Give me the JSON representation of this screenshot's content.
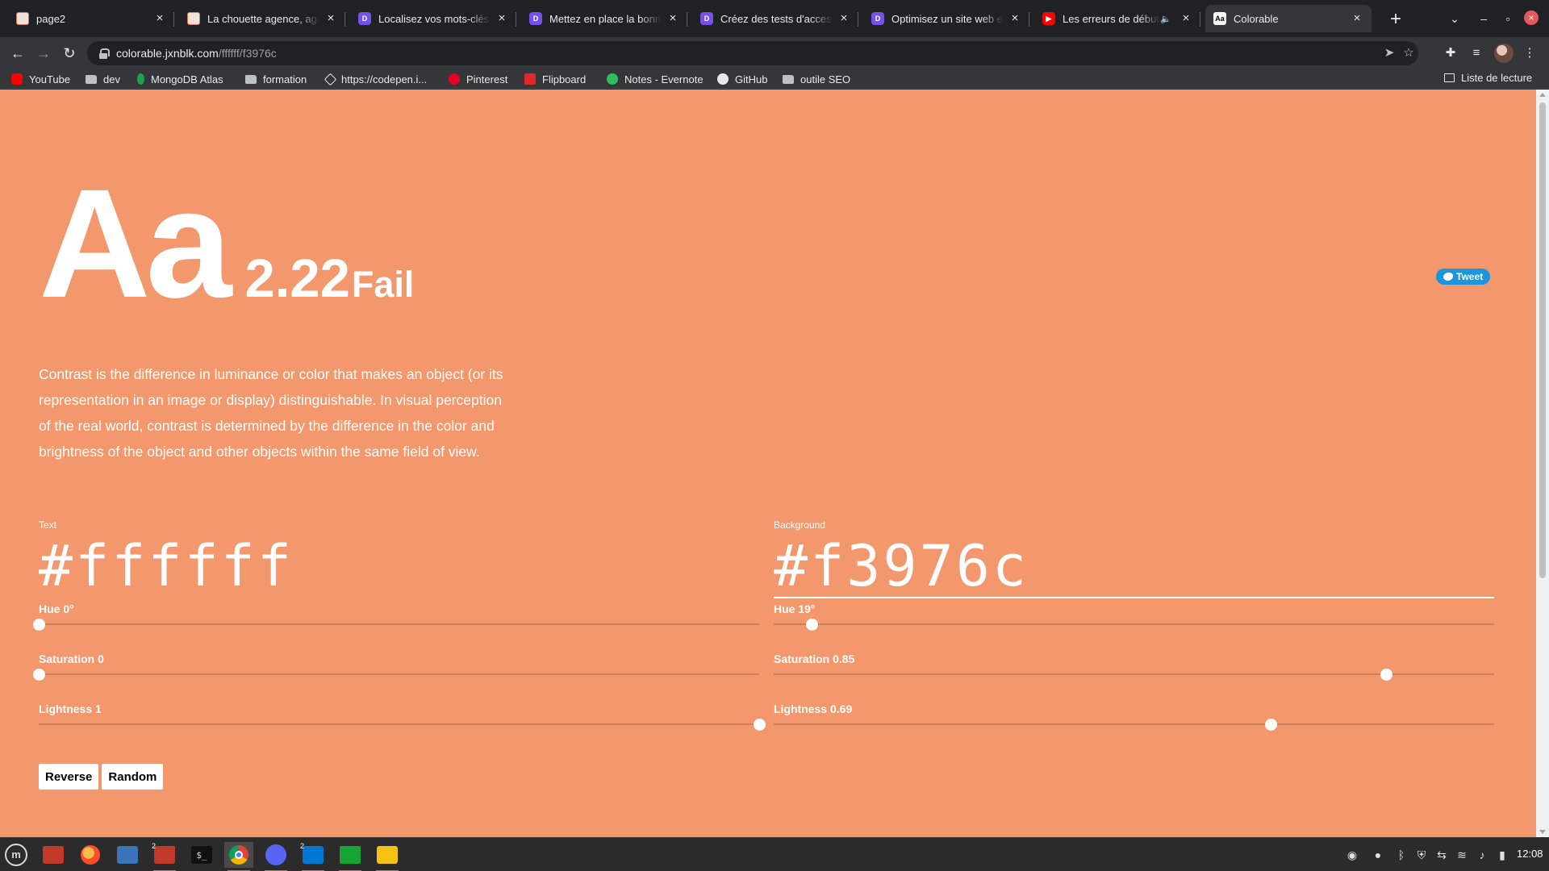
{
  "browser": {
    "tabs": [
      {
        "title": "page2",
        "icon": "agency-favicon-icon"
      },
      {
        "title": "La chouette agence, agence",
        "icon": "agency-favicon-icon"
      },
      {
        "title": "Localisez vos mots-clés -",
        "icon": "openclassrooms-icon"
      },
      {
        "title": "Mettez en place la bonne",
        "icon": "openclassrooms-icon"
      },
      {
        "title": "Créez des tests d'accessib",
        "icon": "openclassrooms-icon"
      },
      {
        "title": "Optimisez un site web ex",
        "icon": "openclassrooms-icon"
      },
      {
        "title": "Les erreurs de début",
        "icon": "youtube-icon"
      },
      {
        "title": "Colorable",
        "icon": "colorable-icon"
      }
    ],
    "active_tab_favicon": "Aa",
    "new_tab": "+",
    "url_host": "colorable.jxnblk.com",
    "url_path": "/ffffff/f3976c",
    "bookmarks": [
      {
        "label": "YouTube"
      },
      {
        "label": "dev"
      },
      {
        "label": "MongoDB Atlas"
      },
      {
        "label": "formation"
      },
      {
        "label": "https://codepen.i..."
      },
      {
        "label": "Pinterest"
      },
      {
        "label": "Flipboard"
      },
      {
        "label": "Notes - Evernote"
      },
      {
        "label": "GitHub"
      },
      {
        "label": "outile SEO"
      }
    ],
    "reading_list": "Liste de lecture"
  },
  "page": {
    "background_color": "#f3976c",
    "text_color": "#ffffff",
    "hero_letters": "Aa",
    "contrast_ratio": "2.22",
    "score": "Fail",
    "tweet_label": "Tweet",
    "description": "Contrast is the difference in luminance or color that makes an object (or its representation in an image or display) distinguishable. In visual perception of the real world, contrast is determined by the difference in the color and brightness of the object and other objects within the same field of view.",
    "text_panel": {
      "label": "Text",
      "hex": "#ffffff",
      "hue_label": "Hue 0°",
      "hue_value": 0,
      "saturation_label": "Saturation 0",
      "saturation_value": 0,
      "lightness_label": "Lightness 1",
      "lightness_value": 1
    },
    "background_panel": {
      "label": "Background",
      "hex": "#f3976c",
      "hue_label": "Hue 19°",
      "hue_value": 19,
      "saturation_label": "Saturation 0.85",
      "saturation_value": 0.85,
      "lightness_label": "Lightness 0.69",
      "lightness_value": 0.69
    },
    "buttons": {
      "reverse": "Reverse",
      "random": "Random"
    }
  },
  "taskbar": {
    "files_badge": "2",
    "vscode_badge": "2",
    "terminal_glyph": "$_",
    "clock": "12:08"
  }
}
